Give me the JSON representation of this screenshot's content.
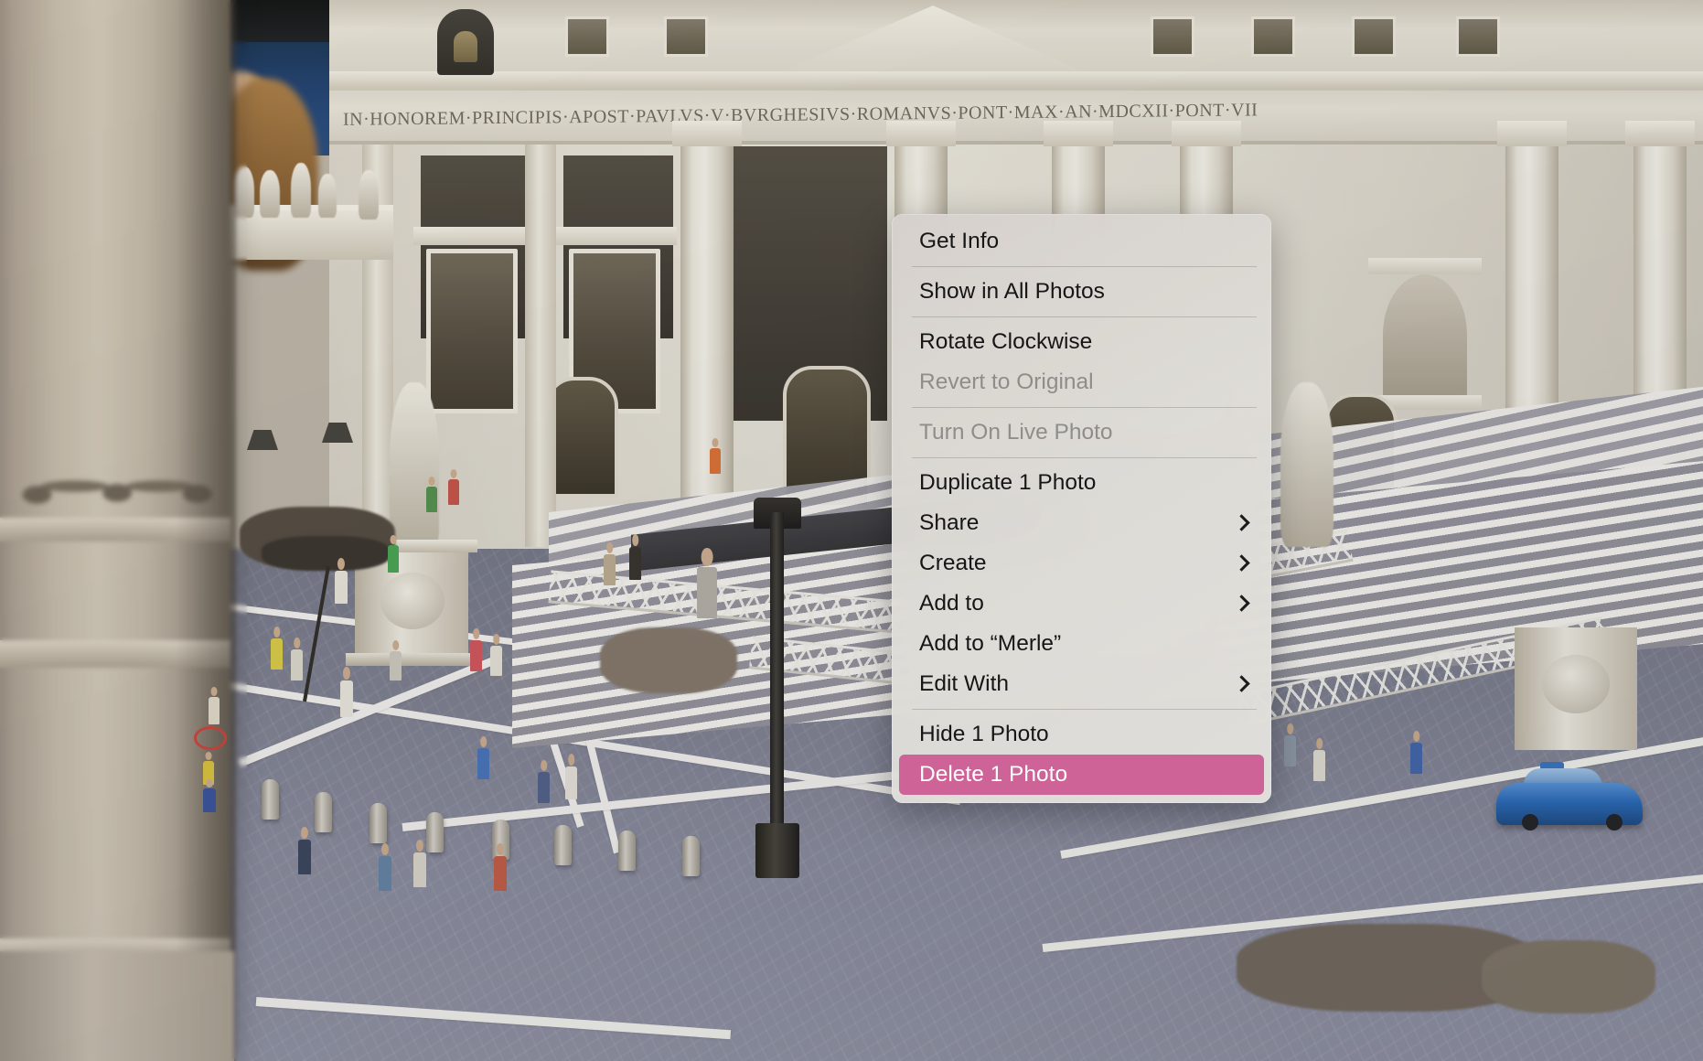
{
  "app": {
    "name": "Photos",
    "platform": "macOS"
  },
  "photo": {
    "description": "Miniature model of St. Peter's Basilica and St. Peter's Square with tiny figurines on a cobbled piazza",
    "facade_inscription": "IN·HONOREM·PRINCIPIS·APOST·PAVLVS·V·BVRGHESIVS·ROMANVS·PONT·MAX·AN·MDCXII·PONT·VII",
    "colors": {
      "sky": "#1b4177",
      "facade_stone": "#e4e0d5",
      "pavement": "#83869a",
      "foreground_column": "#c3b9a9",
      "police_car": "#1f63b8"
    }
  },
  "context_menu": {
    "name": "photo-context-menu",
    "highlight_color": "#cd6397",
    "background_color": "#ddddd8",
    "groups": [
      {
        "items": [
          {
            "id": "get-info",
            "label": "Get Info",
            "enabled": true,
            "submenu": false,
            "selected": false
          }
        ]
      },
      {
        "items": [
          {
            "id": "show-in-all-photos",
            "label": "Show in All Photos",
            "enabled": true,
            "submenu": false,
            "selected": false
          }
        ]
      },
      {
        "items": [
          {
            "id": "rotate-clockwise",
            "label": "Rotate Clockwise",
            "enabled": true,
            "submenu": false,
            "selected": false
          },
          {
            "id": "revert-to-original",
            "label": "Revert to Original",
            "enabled": false,
            "submenu": false,
            "selected": false
          }
        ]
      },
      {
        "items": [
          {
            "id": "turn-on-live-photo",
            "label": "Turn On Live Photo",
            "enabled": false,
            "submenu": false,
            "selected": false
          }
        ]
      },
      {
        "items": [
          {
            "id": "duplicate-1-photo",
            "label": "Duplicate 1 Photo",
            "enabled": true,
            "submenu": false,
            "selected": false
          },
          {
            "id": "share",
            "label": "Share",
            "enabled": true,
            "submenu": true,
            "selected": false
          },
          {
            "id": "create",
            "label": "Create",
            "enabled": true,
            "submenu": true,
            "selected": false
          },
          {
            "id": "add-to",
            "label": "Add to",
            "enabled": true,
            "submenu": true,
            "selected": false
          },
          {
            "id": "add-to-merle",
            "label": "Add to “Merle”",
            "enabled": true,
            "submenu": false,
            "selected": false
          },
          {
            "id": "edit-with",
            "label": "Edit With",
            "enabled": true,
            "submenu": true,
            "selected": false
          }
        ]
      },
      {
        "items": [
          {
            "id": "hide-1-photo",
            "label": "Hide 1 Photo",
            "enabled": true,
            "submenu": false,
            "selected": false
          },
          {
            "id": "delete-1-photo",
            "label": "Delete 1 Photo",
            "enabled": true,
            "submenu": false,
            "selected": true
          }
        ]
      }
    ]
  }
}
